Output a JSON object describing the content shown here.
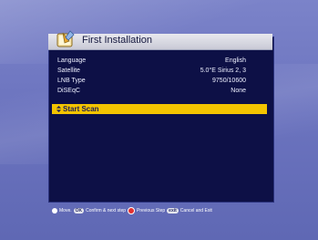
{
  "window": {
    "title": "First Installation"
  },
  "settings": [
    {
      "label": "Language",
      "value": "English"
    },
    {
      "label": "Satellite",
      "value": "5.0°E Sirius 2, 3"
    },
    {
      "label": "LNB Type",
      "value": "9750/10600"
    },
    {
      "label": "DiSEqC",
      "value": "None"
    }
  ],
  "action": {
    "label": "Start Scan"
  },
  "footer": {
    "move": "Move.",
    "ok_key": "OK",
    "ok_text": "Confirm & next step",
    "prev_text": "Previous Step",
    "exit_key": "exit",
    "exit_text": "Cancel and Exit"
  },
  "colors": {
    "backdrop": "#6c74bf",
    "panel": "#0d1046",
    "highlight": "#f3c400"
  }
}
